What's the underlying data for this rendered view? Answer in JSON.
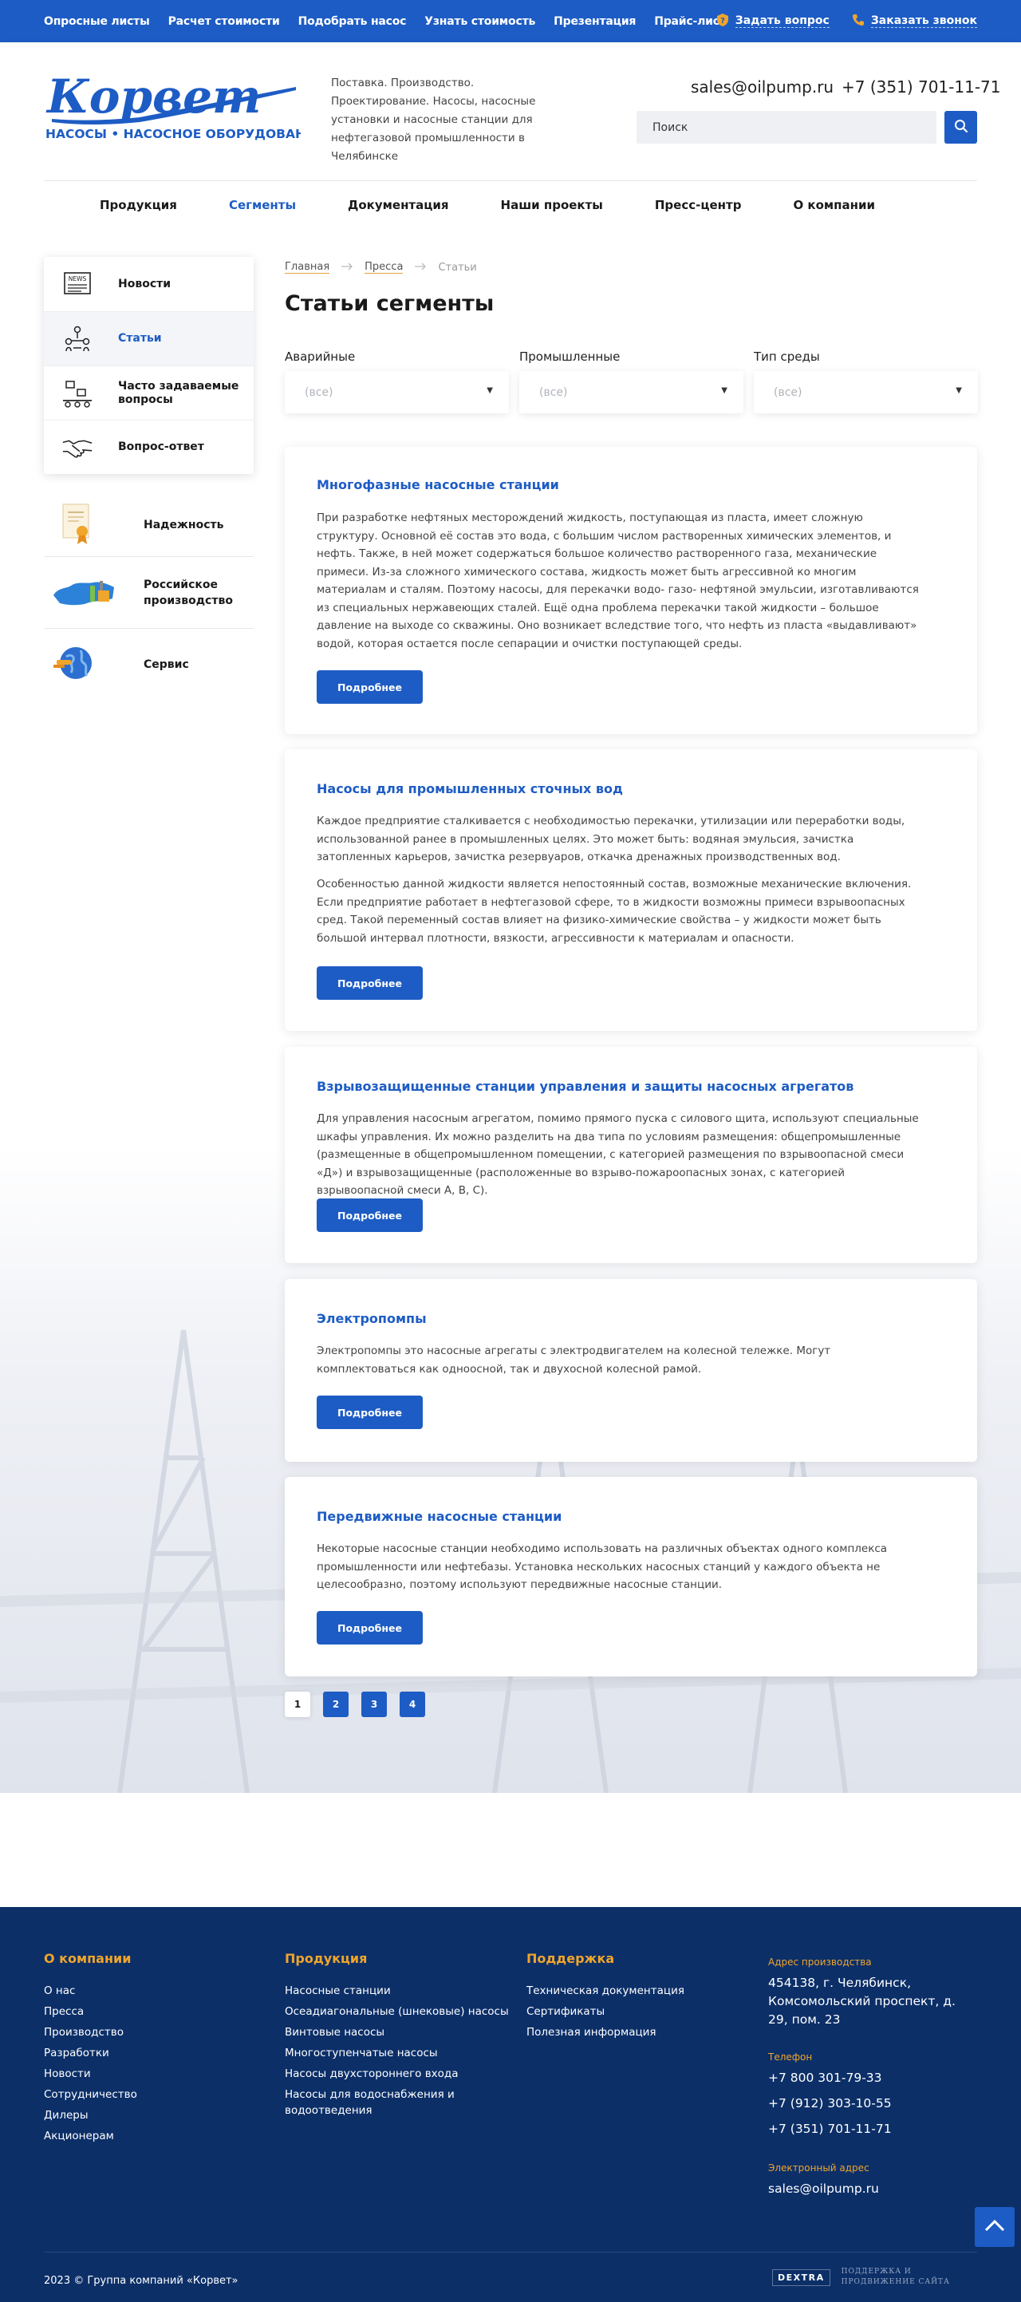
{
  "topbar": {
    "links": [
      "Опросные листы",
      "Расчет стоимости",
      "Подобрать насос",
      "Узнать стоимость",
      "Презентация",
      "Прайс-лист"
    ],
    "ask_question": "Задать вопрос",
    "order_call": "Заказать звонок"
  },
  "header": {
    "logo_name": "Корвет",
    "logo_subtitle": "НАСОСЫ • НАСОСНОЕ ОБОРУДОВАНИЕ",
    "tagline": "Поставка. Производство. Проектирование. Насосы, насосные установки и насосные станции для нефтегазовой промышленности в Челябинске",
    "email": "sales@oilpump.ru",
    "phone": "+7 (351) 701-11-71",
    "search_placeholder": "Поиск"
  },
  "nav": {
    "items": [
      "Продукция",
      "Сегменты",
      "Документация",
      "Наши проекты",
      "Пресс-центр",
      "О компании"
    ],
    "active": "Сегменты"
  },
  "sidebar": {
    "menu": [
      {
        "label": "Новости",
        "icon": "newspaper-icon"
      },
      {
        "label": "Статьи",
        "icon": "people-network-icon",
        "active": true
      },
      {
        "label": "Часто задаваемые вопросы",
        "icon": "conveyor-icon"
      },
      {
        "label": "Вопрос-ответ",
        "icon": "handshake-icon"
      }
    ],
    "promo": [
      {
        "label": "Надежность",
        "icon": "certificate-icon"
      },
      {
        "label": "Российское производство",
        "icon": "russia-factory-icon"
      },
      {
        "label": "Сервис",
        "icon": "globe-service-icon"
      }
    ]
  },
  "breadcrumbs": [
    "Главная",
    "Пресса",
    "Статьи"
  ],
  "page_title": "Статьи сегменты",
  "filters": [
    {
      "label": "Аварийные",
      "value": "(все)"
    },
    {
      "label": "Промышленные",
      "value": "(все)"
    },
    {
      "label": "Тип среды",
      "value": "(все)"
    }
  ],
  "articles": [
    {
      "title": "Многофазные насосные станции",
      "paragraphs": [
        "При разработке нефтяных месторождений жидкость, поступающая из пласта, имеет сложную структуру. Основной её состав это вода, с большим числом растворенных химических элементов, и нефть. Также, в ней может содержаться большое количество растворенного газа, механические примеси. Из-за сложного химического состава, жидкость может быть агрессивной ко многим материалам и сталям. Поэтому насосы, для перекачки водо- газо- нефтяной эмульсии, изготавливаются из специальных нержавеющих сталей. Ещё одна проблема перекачки такой жидкости – большое давление на выходе со скважины. Оно возникает вследствие того, что нефть из пласта «выдавливают» водой, которая остается после сепарации и очистки поступающей среды."
      ],
      "button": "Подробнее"
    },
    {
      "title": "Насосы для промышленных сточных вод",
      "paragraphs": [
        "Каждое предприятие сталкивается с необходимостью перекачки, утилизации или переработки воды, использованной ранее в промышленных целях. Это может быть: водяная эмульсия, зачистка затопленных карьеров, зачистка резервуаров, откачка дренажных производственных вод.",
        "Особенностью данной жидкости является непостоянный состав, возможные механические включения. Если предприятие работает в нефтегазовой сфере, то в жидкости возможны примеси взрывоопасных сред. Такой переменный состав влияет на физико-химические свойства – у жидкости может быть большой интервал плотности, вязкости, агрессивности к материалам и опасности."
      ],
      "button": "Подробнее"
    },
    {
      "title": "Взрывозащищенные станции управления и защиты насосных агрегатов",
      "paragraphs": [
        "Для управления насосным агрегатом, помимо прямого пуска с силового щита, используют специальные шкафы управления. Их можно разделить на два типа по условиям размещения: общепромышленные (размещенные в общепромышленном помещении, с категорией размещения по взрывоопасной смеси «Д») и взрывозащищенные (расположенные во взрыво-пожароопасных зонах, с категорией взрывоопасной смеси А, В, С)."
      ],
      "button": "Подробнее"
    },
    {
      "title": "Электропомпы",
      "paragraphs": [
        "Электропомпы это насосные агрегаты с электродвигателем на колесной тележке. Могут комплектоваться как одноосной, так и двухосной колесной рамой."
      ],
      "button": "Подробнее"
    },
    {
      "title": "Передвижные насосные станции",
      "paragraphs": [
        "Некоторые насосные станции необходимо использовать на различных объектах одного комплекса промышленности или нефтебазы. Установка нескольких насосных станций у каждого объекта не целесообразно, поэтому используют передвижные насосные станции."
      ],
      "button": "Подробнее"
    }
  ],
  "pagination": {
    "pages": [
      "1",
      "2",
      "3",
      "4"
    ],
    "current": "1"
  },
  "footer": {
    "columns": [
      {
        "heading": "О компании",
        "links": [
          "О нас",
          "Пресса",
          "Производство",
          "Разработки",
          "Новости",
          "Сотрудничество",
          "Дилеры",
          "Акционерам"
        ]
      },
      {
        "heading": "Продукция",
        "links": [
          "Насосные станции",
          "Осеадиагональные (шнековые) насосы",
          "Винтовые насосы",
          "Многоступенчатые насосы",
          "Насосы двухстороннего входа",
          "Насосы для водоснабжения и водоотведения"
        ]
      },
      {
        "heading": "Поддержка",
        "links": [
          "Техническая документация",
          "Сертификаты",
          "Полезная информация"
        ]
      }
    ],
    "address_label": "Адрес производства",
    "address": "454138, г. Челябинск, Комсомольский проспект, д. 29, пом. 23",
    "phone_label": "Телефон",
    "phones": [
      "+7 800 301-79-33",
      "+7 (912) 303-10-55",
      "+7 (351) 701-11-71"
    ],
    "email_label": "Электронный адрес",
    "email": "sales@oilpump.ru",
    "copyright": "2023 © Группа компаний «Корвет»",
    "developer": "DEXTRA",
    "developer_text": "ПОДДЕРЖКА И ПРОДВИЖЕНИЕ САЙТА"
  },
  "colors": {
    "brand_blue": "#1d5cc4",
    "footer_navy": "#0c2f68",
    "accent_orange": "#f0a52b"
  }
}
